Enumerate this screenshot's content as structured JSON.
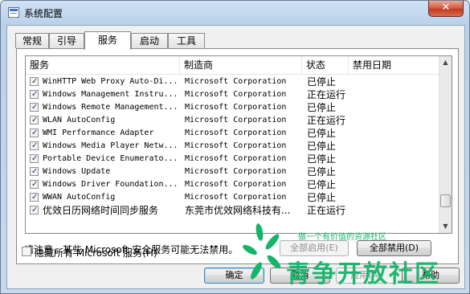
{
  "window": {
    "title": "系统配置",
    "close_label": "✕"
  },
  "tabs": [
    {
      "label": "常规",
      "active": false
    },
    {
      "label": "引导",
      "active": false
    },
    {
      "label": "服务",
      "active": true
    },
    {
      "label": "启动",
      "active": false
    },
    {
      "label": "工具",
      "active": false
    }
  ],
  "columns": {
    "service": "服务",
    "manufacturer": "制造商",
    "status": "状态",
    "disabled_date": "禁用日期"
  },
  "rows": [
    {
      "service": "WinHTTP Web Proxy Auto-Di...",
      "manufacturer": "Microsoft Corporation",
      "status": "已停止",
      "checked": true
    },
    {
      "service": "Windows Management Instru...",
      "manufacturer": "Microsoft Corporation",
      "status": "正在运行",
      "checked": true
    },
    {
      "service": "Windows Remote Management...",
      "manufacturer": "Microsoft Corporation",
      "status": "已停止",
      "checked": true
    },
    {
      "service": "WLAN AutoConfig",
      "manufacturer": "Microsoft Corporation",
      "status": "正在运行",
      "checked": true
    },
    {
      "service": "WMI Performance Adapter",
      "manufacturer": "Microsoft Corporation",
      "status": "已停止",
      "checked": true
    },
    {
      "service": "Windows Media Player Netw...",
      "manufacturer": "Microsoft Corporation",
      "status": "已停止",
      "checked": true
    },
    {
      "service": "Portable Device Enumerato...",
      "manufacturer": "Microsoft Corporation",
      "status": "已停止",
      "checked": true
    },
    {
      "service": "Windows Update",
      "manufacturer": "Microsoft Corporation",
      "status": "已停止",
      "checked": true
    },
    {
      "service": "Windows Driver Foundation...",
      "manufacturer": "Microsoft Corporation",
      "status": "已停止",
      "checked": true
    },
    {
      "service": "WWAN AutoConfig",
      "manufacturer": "Microsoft Corporation",
      "status": "已停止",
      "checked": true
    },
    {
      "service": "优效日历网络时间同步服务",
      "manufacturer": "东莞市优效网络科技有...",
      "status": "正在运行",
      "checked": true
    }
  ],
  "note": "请注意，某些 Microsoft 安全服务可能无法禁用。",
  "buttons": {
    "enable_all": "全部启用(E)",
    "disable_all": "全部禁用(D)",
    "ok": "确定",
    "cancel": "取消",
    "apply": "应用(A)",
    "help": "帮助"
  },
  "hide_microsoft": {
    "label": "隐藏所有 Microsoft 服务(H)",
    "checked": false
  },
  "watermark": {
    "title": "青争开放社区",
    "subtitle": "做一个有价值的资源社区"
  },
  "colors": {
    "accent_green": "#16b46a",
    "close_red": "#c03a1e"
  }
}
